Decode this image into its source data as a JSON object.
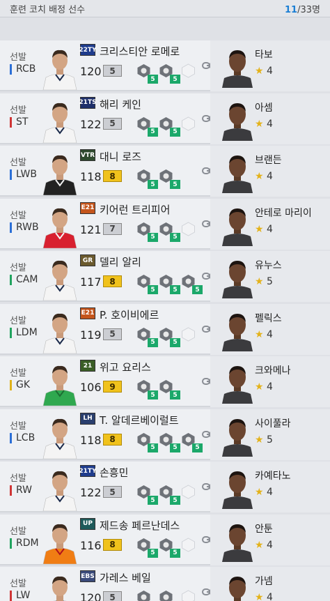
{
  "header": {
    "title": "훈련 코치 배정 선수",
    "count_current": "11",
    "count_total": "/33명"
  },
  "colors": {
    "accent": "#1c7fd4",
    "skill_green": "#1ba86a",
    "gold_grade": "#f0c21c",
    "silver_grade": "#ccced3",
    "star": "#e3b21a"
  },
  "rows": [
    {
      "start": "선발",
      "position": "RCB",
      "pos_color": "#2b6fd6",
      "season": "22TY",
      "season_bg": "#1f3c8c",
      "player": "크리스티안 로메로",
      "ovr": "120",
      "grade": "5",
      "grade_type": "silver",
      "skills": [
        "5",
        "5"
      ],
      "slots": 1,
      "kit": "white",
      "coach": "타보",
      "coach_level": "4"
    },
    {
      "start": "선발",
      "position": "ST",
      "pos_color": "#cf3535",
      "season": "21TS",
      "season_bg": "#1e2f6a",
      "player": "해리 케인",
      "ovr": "122",
      "grade": "5",
      "grade_type": "silver",
      "skills": [
        "5",
        "5"
      ],
      "slots": 1,
      "kit": "white",
      "coach": "아셈",
      "coach_level": "4"
    },
    {
      "start": "선발",
      "position": "LWB",
      "pos_color": "#2b6fd6",
      "season": "VTR",
      "season_bg": "#2e4a2e",
      "player": "대니 로즈",
      "ovr": "118",
      "grade": "8",
      "grade_type": "gold",
      "skills": [
        "5",
        "5"
      ],
      "slots": 0,
      "kit": "stripe",
      "coach": "브랜든",
      "coach_level": "4"
    },
    {
      "start": "선발",
      "position": "RWB",
      "pos_color": "#2b6fd6",
      "season": "E21",
      "season_bg": "#c4551c",
      "player": "키어런 트리피어",
      "ovr": "121",
      "grade": "7",
      "grade_type": "silver",
      "skills": [
        "5",
        "5"
      ],
      "slots": 1,
      "kit": "red",
      "coach": "안테로 마리이",
      "coach_level": "4"
    },
    {
      "start": "선발",
      "position": "CAM",
      "pos_color": "#21a35f",
      "season": "GR",
      "season_bg": "#6b5a2e",
      "player": "델리 알리",
      "ovr": "117",
      "grade": "8",
      "grade_type": "gold",
      "skills": [
        "5",
        "5",
        "5"
      ],
      "slots": 0,
      "kit": "white",
      "coach": "유누스",
      "coach_level": "5"
    },
    {
      "start": "선발",
      "position": "LDM",
      "pos_color": "#21a35f",
      "season": "E21",
      "season_bg": "#c4551c",
      "player": "P. 호이비에르",
      "ovr": "119",
      "grade": "5",
      "grade_type": "silver",
      "skills": [
        "5",
        "5"
      ],
      "slots": 1,
      "kit": "white",
      "coach": "펠릭스",
      "coach_level": "4"
    },
    {
      "start": "선발",
      "position": "GK",
      "pos_color": "#e0b21a",
      "season": "21",
      "season_bg": "#3a5e26",
      "player": "위고 요리스",
      "ovr": "106",
      "grade": "9",
      "grade_type": "gold",
      "skills": [
        "5",
        "5"
      ],
      "slots": 0,
      "kit": "green",
      "coach": "크와메나",
      "coach_level": "4"
    },
    {
      "start": "선발",
      "position": "LCB",
      "pos_color": "#2b6fd6",
      "season": "LH",
      "season_bg": "#2a3f6e",
      "player": "T. 알데르베이럴트",
      "ovr": "118",
      "grade": "8",
      "grade_type": "gold",
      "skills": [
        "5",
        "5",
        "5"
      ],
      "slots": 0,
      "kit": "white",
      "coach": "사이풀라",
      "coach_level": "5"
    },
    {
      "start": "선발",
      "position": "RW",
      "pos_color": "#cf3535",
      "season": "21TY",
      "season_bg": "#1f3c8c",
      "player": "손흥민",
      "ovr": "122",
      "grade": "5",
      "grade_type": "silver",
      "skills": [
        "5",
        "5"
      ],
      "slots": 1,
      "kit": "white",
      "coach": "카예타노",
      "coach_level": "4"
    },
    {
      "start": "선발",
      "position": "RDM",
      "pos_color": "#21a35f",
      "season": "UP",
      "season_bg": "#1e5a5a",
      "player": "제드송 페르난데스",
      "ovr": "116",
      "grade": "8",
      "grade_type": "gold",
      "skills": [
        "5",
        "5"
      ],
      "slots": 1,
      "kit": "orange",
      "coach": "안툰",
      "coach_level": "4"
    },
    {
      "start": "선발",
      "position": "LW",
      "pos_color": "#cf3535",
      "season": "EBS",
      "season_bg": "#3a4a7a",
      "player": "가레스 베일",
      "ovr": "120",
      "grade": "5",
      "grade_type": "silver",
      "skills": [
        "5",
        "5"
      ],
      "slots": 1,
      "kit": "white",
      "coach": "가넴",
      "coach_level": "4"
    }
  ]
}
